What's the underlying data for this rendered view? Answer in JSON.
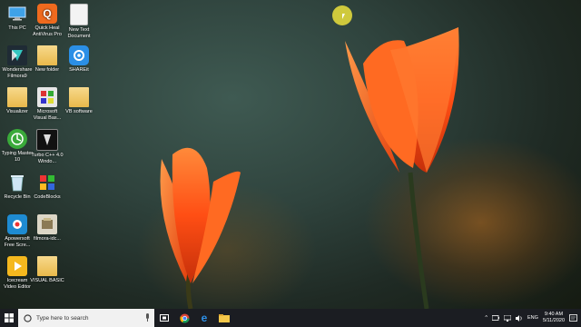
{
  "desktop": {
    "icons": [
      {
        "label": "This PC",
        "icon": "computer-icon"
      },
      {
        "label": "Quick Heal AntiVirus Pro",
        "icon": "quickheal-icon"
      },
      {
        "label": "New Text Document",
        "icon": "text-document-icon"
      },
      {
        "label": "Wondershare Filmora9",
        "icon": "filmora-icon"
      },
      {
        "label": "New folder",
        "icon": "folder-icon"
      },
      {
        "label": "SHAREit",
        "icon": "shareit-icon"
      },
      {
        "label": "Visualizer",
        "icon": "folder-icon"
      },
      {
        "label": "Microsoft Visual Bas...",
        "icon": "visual-basic-icon"
      },
      {
        "label": "VB software",
        "icon": "folder-icon"
      },
      {
        "label": "Typing Master 10",
        "icon": "typing-master-icon"
      },
      {
        "label": "Turbo C++ 4.0 Windo...",
        "icon": "turbo-cpp-icon"
      },
      {
        "label": "Recycle Bin",
        "icon": "recycle-bin-icon"
      },
      {
        "label": "CodeBlocks",
        "icon": "codeblocks-icon"
      },
      {
        "label": "Apowersoft Free Scre...",
        "icon": "apowersoft-icon"
      },
      {
        "label": "filmora-idc...",
        "icon": "installer-icon"
      },
      {
        "label": "Icecream Video Editor",
        "icon": "icecream-icon"
      },
      {
        "label": "VISUAL BASIC",
        "icon": "folder-icon"
      }
    ]
  },
  "taskbar": {
    "search_placeholder": "Type here to search",
    "language": "ENG",
    "time": "9:40 AM",
    "date": "5/11/2020"
  },
  "colors": {
    "taskbar": "#1b1d22",
    "tulip": "#ff5a1a",
    "cursor_highlight": "#ebe13c"
  }
}
